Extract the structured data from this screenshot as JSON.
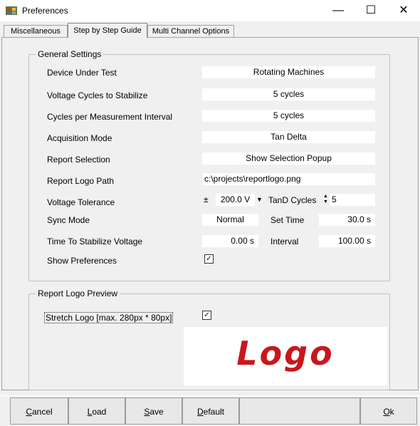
{
  "window": {
    "title": "Preferences"
  },
  "tabs": [
    {
      "label": "Miscellaneous"
    },
    {
      "label": "Step by Step Guide"
    },
    {
      "label": "Multi Channel Options"
    }
  ],
  "general_settings": {
    "legend": "General Settings",
    "device_under_test": {
      "label": "Device Under Test",
      "value": "Rotating Machines"
    },
    "voltage_cycles": {
      "label": "Voltage Cycles to Stabilize",
      "value": "5 cycles"
    },
    "cycles_per_interval": {
      "label": "Cycles per Measurement Interval",
      "value": "5 cycles"
    },
    "acquisition_mode": {
      "label": "Acquisition Mode",
      "value": "Tan Delta"
    },
    "report_selection": {
      "label": "Report Selection",
      "value": "Show Selection Popup"
    },
    "report_logo_path": {
      "label": "Report Logo Path",
      "value": "c:\\projects\\reportlogo.png"
    },
    "voltage_tolerance": {
      "label": "Voltage Tolerance",
      "prefix": "±",
      "value": "200.0 V"
    },
    "tand_cycles": {
      "label": "TanD Cycles",
      "value": "5"
    },
    "sync_mode": {
      "label": "Sync Mode",
      "value": "Normal"
    },
    "set_time": {
      "label": "Set Time",
      "value": "30.0  s"
    },
    "time_to_stabilize": {
      "label": "Time To Stabilize Voltage",
      "value": "0.00  s"
    },
    "interval": {
      "label": "Interval",
      "value": "100.00  s"
    },
    "show_preferences": {
      "label": "Show Preferences",
      "checked": true
    }
  },
  "logo_preview": {
    "legend": "Report Logo Preview",
    "stretch_label": "Stretch Logo [max. 280px * 80px]",
    "stretch_checked": true,
    "logo_text": "Logo",
    "logo_color": "#c8171d"
  },
  "buttons": {
    "cancel": {
      "mn": "C",
      "rest": "ancel"
    },
    "load": {
      "mn": "L",
      "rest": "oad"
    },
    "save": {
      "mn": "S",
      "rest": "ave"
    },
    "default": {
      "mn": "D",
      "rest": "efault"
    },
    "ok": {
      "mn": "O",
      "rest": "k"
    }
  }
}
